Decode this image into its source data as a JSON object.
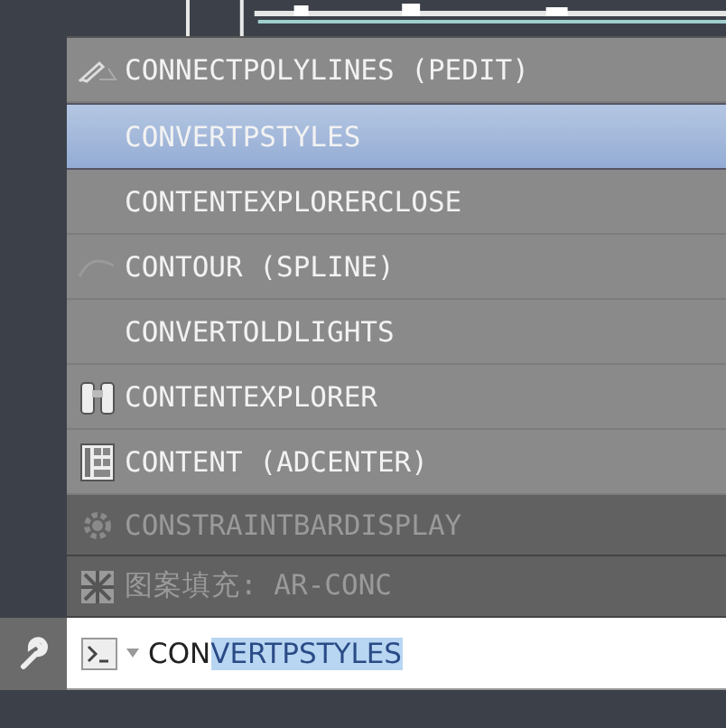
{
  "suggestions": [
    {
      "label": "CONNECTPOLYLINES (PEDIT)",
      "kind": "pencil",
      "selected": false,
      "disabled": false
    },
    {
      "label": "CONVERTPSTYLES",
      "kind": "plain",
      "selected": true,
      "disabled": false
    },
    {
      "label": "CONTENTEXPLORERCLOSE",
      "kind": "plain",
      "selected": false,
      "disabled": false
    },
    {
      "label": "CONTOUR (SPLINE)",
      "kind": "spline",
      "selected": false,
      "disabled": false
    },
    {
      "label": "CONVERTOLDLIGHTS",
      "kind": "plain",
      "selected": false,
      "disabled": false
    },
    {
      "label": "CONTENTEXPLORER",
      "kind": "binoculars",
      "selected": false,
      "disabled": false
    },
    {
      "label": "CONTENT (ADCENTER)",
      "kind": "grid",
      "selected": false,
      "disabled": false
    },
    {
      "label": "CONSTRAINTBARDISPLAY",
      "kind": "gear",
      "selected": false,
      "disabled": true
    },
    {
      "label": "图案填充: AR-CONC",
      "kind": "hatch",
      "selected": false,
      "disabled": true
    }
  ],
  "command_line": {
    "typed": "CON",
    "completion": "VERTPSTYLES"
  }
}
